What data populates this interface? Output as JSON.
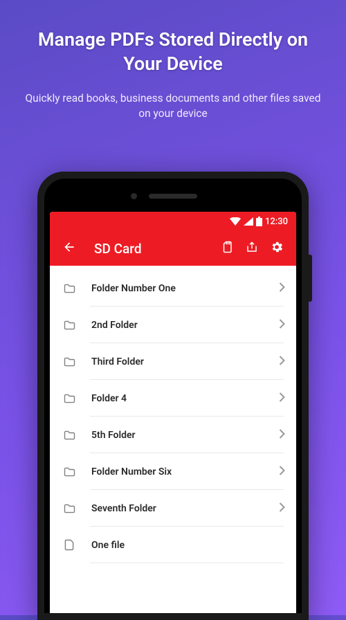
{
  "marketing": {
    "headline": "Manage PDFs Stored Directly on Your Device",
    "subhead": "Quickly read books, business documents and other files saved on your device"
  },
  "statusbar": {
    "time": "12:30"
  },
  "appbar": {
    "title": "SD Card"
  },
  "list": {
    "items": [
      {
        "label": "Folder Number One",
        "type": "folder"
      },
      {
        "label": "2nd Folder",
        "type": "folder"
      },
      {
        "label": "Third Folder",
        "type": "folder"
      },
      {
        "label": "Folder 4",
        "type": "folder"
      },
      {
        "label": "5th Folder",
        "type": "folder"
      },
      {
        "label": "Folder Number Six",
        "type": "folder"
      },
      {
        "label": "Seventh Folder",
        "type": "folder"
      },
      {
        "label": "One file",
        "type": "file"
      }
    ]
  }
}
